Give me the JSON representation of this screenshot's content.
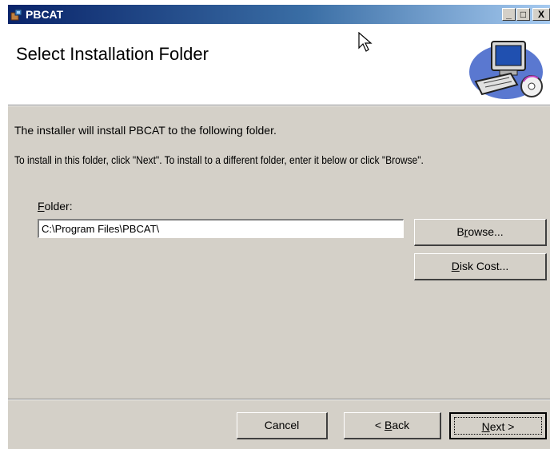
{
  "window": {
    "title": "PBCAT",
    "minimize_glyph": "_",
    "maximize_glyph": "□",
    "close_glyph": "X"
  },
  "banner": {
    "title": "Select Installation Folder"
  },
  "body": {
    "line1": "The installer will install PBCAT to the following folder.",
    "line2": "To install in this folder, click \"Next\". To install to a different folder, enter it below or click \"Browse\"."
  },
  "folder": {
    "label_accel": "F",
    "label_rest": "older:",
    "value": "C:\\Program Files\\PBCAT\\"
  },
  "buttons": {
    "browse_pre": "B",
    "browse_accel": "r",
    "browse_post": "owse...",
    "diskcost_accel": "D",
    "diskcost_post": "isk Cost...",
    "cancel": "Cancel",
    "back_pre": "< ",
    "back_accel": "B",
    "back_post": "ack",
    "next_accel": "N",
    "next_post": "ext >"
  },
  "icons": [
    "installer-app-icon",
    "computer-cd-graphic",
    "mouse-cursor-icon"
  ]
}
